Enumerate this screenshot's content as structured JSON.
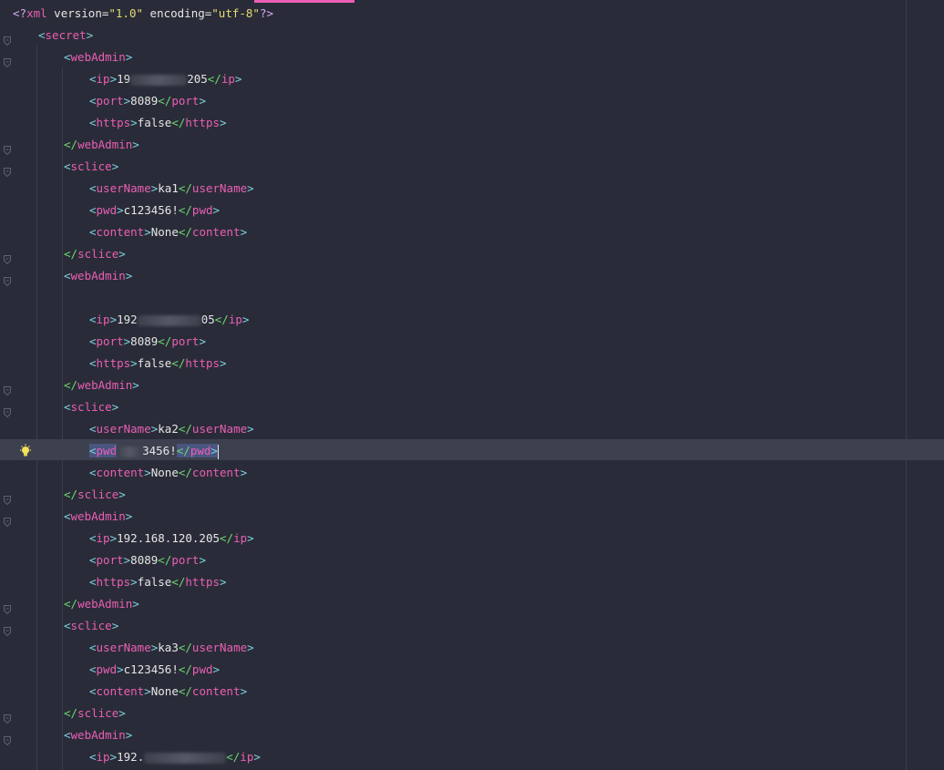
{
  "prolog": {
    "open": "<?",
    "name": "xml",
    "attr1": " version=",
    "val1": "\"1.0\"",
    "attr2": " encoding=",
    "val2": "\"utf-8\"",
    "close": "?>"
  },
  "tags": {
    "secret": "secret",
    "webAdmin": "webAdmin",
    "sclice": "sclice",
    "ip": "ip",
    "port": "port",
    "https": "https",
    "userName": "userName",
    "pwd": "pwd",
    "content": "content"
  },
  "values": {
    "ip1_start": "19",
    "ip1_end": "205",
    "ip2_start": "192",
    "ip2_end": "05",
    "ip3": "192.168.120.205",
    "ip4_start": "192.",
    "ip4_mid": "168.120.",
    "port": "8089",
    "https": "false",
    "user1": "ka1",
    "user2": "ka2",
    "user3": "ka3",
    "pwd": "c123456!",
    "pwd2_partial": "3456!",
    "content": "None"
  },
  "colors": {
    "background": "#292c38",
    "tag": "#ec5eb5",
    "string": "#e6db74",
    "accent": "#ec5eb5"
  },
  "icons": {
    "gutter_hint": "lightbulb-icon",
    "fold": "fold-marker-icon"
  }
}
